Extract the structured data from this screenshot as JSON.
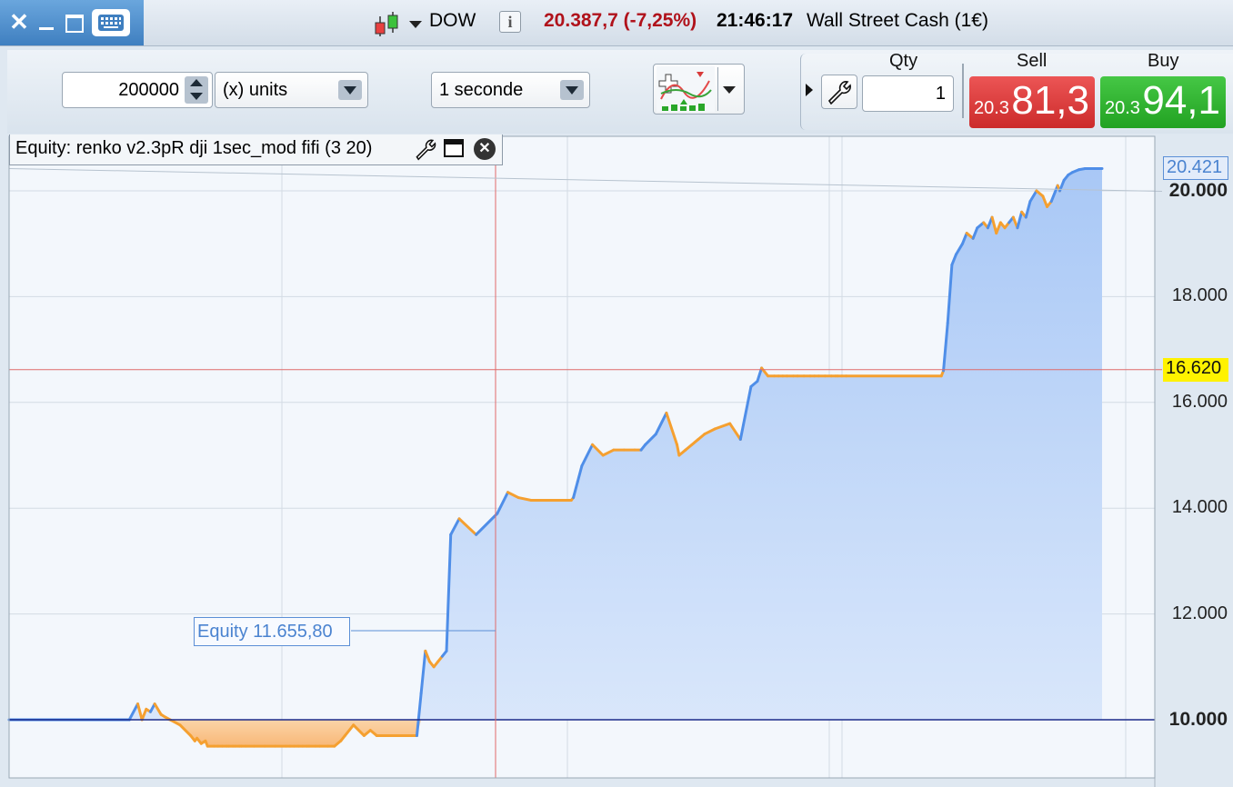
{
  "window": {
    "close": "✕",
    "minimize": "▁",
    "maximize": "☐"
  },
  "header": {
    "symbol": "DOW",
    "price": "20.387,7",
    "change": "(-7,25%)",
    "time": "21:46:17",
    "instrument": "Wall Street Cash (1€)"
  },
  "toolbar": {
    "quantity": "200000",
    "units_select": "(x) units",
    "interval_select": "1 seconde"
  },
  "trade": {
    "qty_label": "Qty",
    "qty_value": "1",
    "sell_label": "Sell",
    "buy_label": "Buy",
    "sell_small": "20.3",
    "sell_big": "81,3",
    "buy_small": "20.3",
    "buy_big": "94,1"
  },
  "chart_panel": {
    "title": "Equity: renko v2.3pR dji 1sec_mod fifi (3 20)",
    "equity_label": "Equity  11.655,80",
    "last_value_tag": "20.421",
    "crosshair_value_tag": "16.620"
  },
  "colors": {
    "accent": "#4f8ee8",
    "drawdown": "#f5a030",
    "sell": "#d83a3a",
    "buy": "#2cae2c",
    "crosshair": "#e06a6a",
    "baseline": "#1a2a8a",
    "price_red": "#b0121b"
  },
  "chart_data": {
    "type": "area",
    "title": "Equity: renko v2.3pR dji 1sec_mod fifi (3 20)",
    "ylim": [
      9000,
      21000
    ],
    "yticks": [
      "20.000",
      "18.000",
      "16.000",
      "14.000",
      "12.000",
      "10.000"
    ],
    "baseline": 10000,
    "crosshair_y": 16620,
    "last_value": 20421,
    "series": [
      {
        "name": "Equity",
        "x": [
          0,
          16,
          20,
          22,
          24,
          26,
          28,
          31,
          33,
          40,
          45,
          47,
          48,
          50,
          52,
          53,
          56,
          58,
          60,
          62,
          63,
          65,
          66,
          68,
          69,
          71,
          75,
          80,
          85,
          90,
          92,
          94,
          96,
          98,
          100,
          101,
          104,
          106,
          110,
          113,
          116,
          118,
          122,
          127,
          130,
          133,
          135,
          138,
          140,
          141,
          142,
          143,
          145,
          146,
          148,
          150,
          152,
          154,
          156,
          158,
          160,
          162,
          164,
          166,
          168,
          172,
          180,
          190,
          195,
          200,
          206,
          215,
          225,
          226,
          228,
          230,
          235,
          240,
          245,
          250,
          255,
          258,
          260,
          265,
          270,
          275,
          276,
          279,
          282,
          285,
          288,
          293,
          300,
          305,
          310,
          313,
          315,
          318,
          321,
          323,
          325,
          327,
          330,
          332,
          335,
          338,
          340,
          342,
          345,
          348,
          350,
          351,
          353,
          355,
          400,
          401,
          403,
          405,
          407,
          410,
          412,
          415,
          417,
          420,
          422,
          424,
          426,
          428,
          430,
          432,
          434,
          436,
          438,
          440,
          442,
          445,
          448,
          450,
          452,
          455,
          456,
          458,
          460,
          462,
          465,
          468,
          470,
          473,
          475,
          476
        ],
        "y": [
          10000,
          10000,
          10300,
          10000,
          10200,
          10150,
          10300,
          10100,
          10050,
          9900,
          9700,
          9600,
          9650,
          9550,
          9600,
          9500,
          9500,
          9500,
          9500,
          9500,
          9500,
          9500,
          9500,
          9500,
          9500,
          9500,
          9500,
          9500,
          9500,
          9500,
          9500,
          9500,
          9500,
          9500,
          9500,
          9500,
          9500,
          9500,
          9500,
          9500,
          9600,
          9700,
          9900,
          9700,
          9800,
          9700,
          9700,
          9700,
          9700,
          9700,
          9700,
          9700,
          9700,
          9700,
          9700,
          9700,
          9700,
          10500,
          11300,
          11100,
          11000,
          11100,
          11200,
          11300,
          13500,
          13800,
          13500,
          13900,
          14300,
          14200,
          14150,
          14150,
          14150,
          14200,
          14500,
          14800,
          15200,
          15000,
          15100,
          15100,
          15100,
          15100,
          15200,
          15400,
          15800,
          15200,
          15000,
          15100,
          15200,
          15300,
          15400,
          15500,
          15600,
          15300,
          16300,
          16400,
          16650,
          16500,
          16500,
          16500,
          16500,
          16500,
          16500,
          16500,
          16500,
          16500,
          16500,
          16500,
          16500,
          16500,
          16500,
          16500,
          16500,
          16500,
          16500,
          16600,
          17500,
          18600,
          18800,
          19000,
          19200,
          19100,
          19300,
          19400,
          19300,
          19500,
          19200,
          19400,
          19300,
          19400,
          19500,
          19300,
          19600,
          19500,
          19800,
          20000,
          19900,
          19700,
          19800,
          20100,
          20000,
          20200,
          20300,
          20350,
          20400,
          20421,
          20421,
          20421,
          20421,
          20421
        ]
      }
    ]
  }
}
